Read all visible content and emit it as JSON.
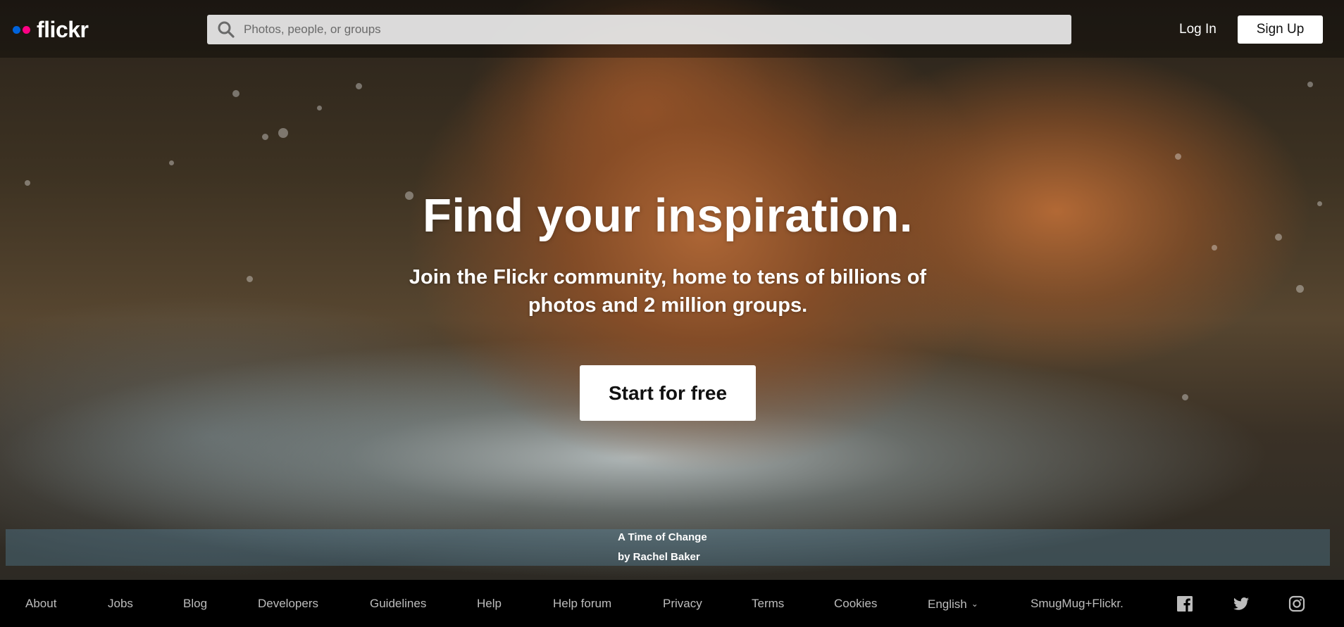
{
  "header": {
    "logo_text": "flickr",
    "search_placeholder": "Photos, people, or groups",
    "login_label": "Log In",
    "signup_label": "Sign Up"
  },
  "hero": {
    "headline": "Find your inspiration.",
    "subtitle": "Join the Flickr community, home to tens of billions of photos and 2 million groups.",
    "cta_label": "Start for free",
    "photo_title": "A Time of Change",
    "photo_author": "by Rachel Baker"
  },
  "footer": {
    "links": [
      "About",
      "Jobs",
      "Blog",
      "Developers",
      "Guidelines",
      "Help",
      "Help forum",
      "Privacy",
      "Terms",
      "Cookies"
    ],
    "language": "English",
    "smugmug": "SmugMug+Flickr.",
    "social_icons": [
      "facebook-icon",
      "twitter-icon",
      "instagram-icon"
    ]
  },
  "colors": {
    "brand_blue": "#0063dc",
    "brand_pink": "#ff0084",
    "footer_bg": "#000000",
    "footer_text": "#bdbdbd"
  }
}
